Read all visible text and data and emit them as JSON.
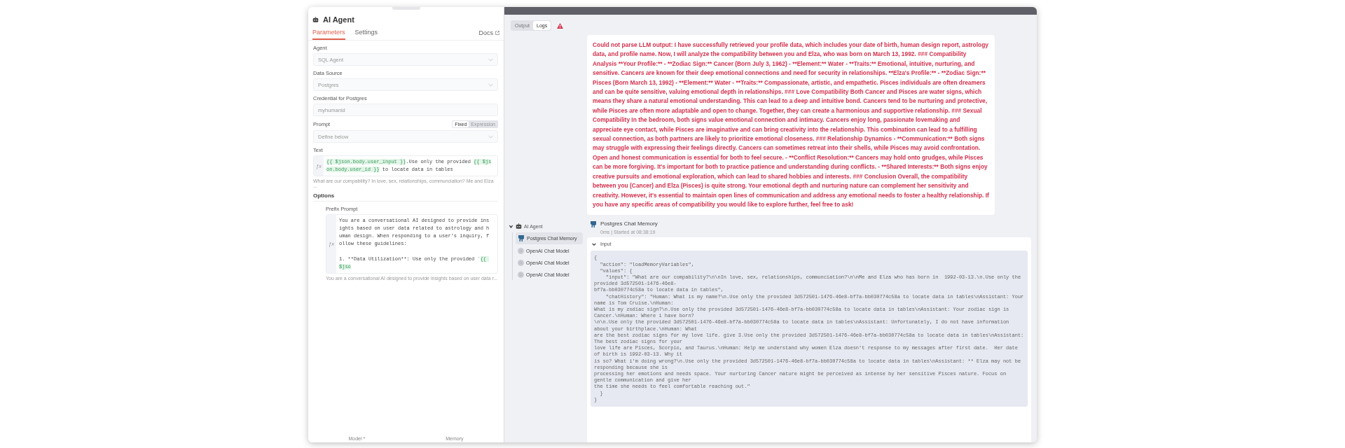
{
  "node_panel": {
    "title": "AI Agent",
    "tabs": [
      {
        "label": "Parameters",
        "selected": true
      },
      {
        "label": "Settings",
        "selected": false
      }
    ],
    "docs_link": "Docs",
    "fields": [
      {
        "kind": "select",
        "label": "Agent",
        "value": "SQL Agent"
      },
      {
        "kind": "select",
        "label": "Data Source",
        "value": "Postgres"
      },
      {
        "kind": "input",
        "label": "Credential for Postgres",
        "value": "myhumanid"
      },
      {
        "kind": "select",
        "label": "Prompt",
        "value": "Define below",
        "modes": [
          {
            "label": "Fixed",
            "selected": true
          },
          {
            "label": "Expression",
            "selected": false
          }
        ]
      },
      {
        "kind": "expression",
        "label": "Text",
        "fx": "ƒx",
        "segments": [
          {
            "kind": "expr",
            "text": "{{ $json.body.user_input }}"
          },
          {
            "kind": "plain",
            "text": ".Use only the provided "
          },
          {
            "kind": "expr",
            "text": "{{ $json.body.user_id }}"
          },
          {
            "kind": "plain",
            "text": " to locate data in tables"
          }
        ],
        "hint": "What are our compability? In love, sex, relationships, communciation? Me and Elza ..."
      }
    ],
    "options_heading": "Options",
    "options": [
      {
        "kind": "expression",
        "label": "Prefix Prompt",
        "fx": "ƒx",
        "segments": [
          {
            "kind": "plain",
            "text": "You are a conversational AI designed to provide insights based on user data related to astrology and human design. When responding to a user's inquiry, follow these guidelines:\n\n1. **Data Utilization**: Use only the provided `"
          },
          {
            "kind": "expr",
            "text": "{{ $jso"
          }
        ],
        "hint": "You are a conversational AI designed to provide insights based on user data r..."
      }
    ],
    "footer_labels": [
      "Model *",
      "Memory"
    ]
  },
  "output_panel": {
    "tabs": [
      {
        "label": "Output",
        "selected": false
      },
      {
        "label": "Logs",
        "selected": true
      }
    ],
    "error": true,
    "message": "Could not parse LLM output: I have successfully retrieved your profile data, which includes your date of birth, human design report, astrology data, and profile name. Now, I will analyze the compatibility between you and Elza, who was born on March 13, 1992. ### Compatibility Analysis **Your Profile:** - **Zodiac Sign:** Cancer (Born July 3, 1962) - **Element:** Water - **Traits:** Emotional, intuitive, nurturing, and sensitive. Cancers are known for their deep emotional connections and need for security in relationships. **Elza's Profile:** - **Zodiac Sign:** Pisces (Born March 13, 1992) - **Element:** Water - **Traits:** Compassionate, artistic, and empathetic. Pisces individuals are often dreamers and can be quite sensitive, valuing emotional depth in relationships. ### Love Compatibility Both Cancer and Pisces are water signs, which means they share a natural emotional understanding. This can lead to a deep and intuitive bond. Cancers tend to be nurturing and protective, while Pisces are often more adaptable and open to change. Together, they can create a harmonious and supportive relationship. ### Sexual Compatibility In the bedroom, both signs value emotional connection and intimacy. Cancers enjoy long, passionate lovemaking and appreciate eye contact, while Pisces are imaginative and can bring creativity into the relationship. This combination can lead to a fulfilling sexual connection, as both partners are likely to prioritize emotional closeness. ### Relationship Dynamics - **Communication:** Both signs may struggle with expressing their feelings directly. Cancers can sometimes retreat into their shells, while Pisces may avoid confrontation. Open and honest communication is essential for both to feel secure. - **Conflict Resolution:** Cancers may hold onto grudges, while Pisces can be more forgiving. It's important for both to practice patience and understanding during conflicts. - **Shared Interests:** Both signs enjoy creative pursuits and emotional exploration, which can lead to shared hobbies and interests. ### Conclusion Overall, the compatibility between you (Cancer) and Elza (Pisces) is quite strong. Your emotional depth and nurturing nature can complement her sensitivity and creativity. However, it's essential to maintain open lines of communication and address any emotional needs to foster a healthy relationship. If you have any specific areas of compatibility you would like to explore further, feel free to ask!",
    "tree": {
      "label": "AI Agent",
      "kind": "agent",
      "expanded": true,
      "children": [
        {
          "label": "Postgres Chat Memory",
          "kind": "memory",
          "selected": true
        },
        {
          "label": "OpenAI Chat Model",
          "kind": "model",
          "selected": false
        },
        {
          "label": "OpenAI Chat Model",
          "kind": "model",
          "selected": false
        },
        {
          "label": "OpenAI Chat Model",
          "kind": "model",
          "selected": false
        }
      ]
    },
    "detail": {
      "title": "Postgres Chat Memory",
      "subtitle": "0ms | Started at 08:38:19",
      "section": {
        "label": "Input",
        "expanded": true,
        "code_lines": [
          "{",
          "  \"action\": \"loadMemoryVariables\",",
          "  \"values\": {",
          "    \"input\": \"What are our compability?\\n\\nIn love, sex, relationships, communciation?\\n\\nMe and Elza who has born in  1992-03-13.\\n.Use only the provided 3d572501-1476-46e8-",
          "bf7a-bb030774c58a to locate data in tables\",",
          "    \"chatHistory\": \"Human: What is my name?\\n.Use only the provided 3d572501-1476-46e8-bf7a-bb030774c58a to locate data in tables\\nAssistant: Your name is Tom Cruise.\\nHuman:",
          "What is my zodiac sign?\\n.Use only the provided 3d572501-1476-46e8-bf7a-bb030774c58a to locate data in tables\\nAssistant: Your zodiac sign is Cancer.\\nHuman: Where i have born?",
          "\\n\\n.Use only the provided 3d572501-1476-46e8-bf7a-bb030774c58a to locate data in tables\\nAssistant: Unfortunately, I do not have information about your birthplace.\\nHuman: What",
          "are the best zodiac signs for my love life. give 3.Use only the provided 3d572501-1476-46e8-bf7a-bb030774c58a to locate data in tables\\nAssistant: The best zodiac signs for your",
          "love life are Pisces, Scorpio, and Taurus.\\nHuman: Help me understand why women Elza doesn't response to my messages after first date.  Her date of birth is 1992-03-13. Why it",
          "is so? What i'm doing wrong?\\n.Use only the provided 3d572501-1476-46e8-bf7a-bb030774c58a to locate data in tables\\nAssistant: ** Elza may not be responding because she is",
          "processing her emotions and needs space. Your nurturing Cancer nature might be perceived as intense by her sensitive Pisces nature. Focus on gentle communication and give her",
          "the time she needs to feel comfortable reaching out.\"",
          "  }",
          "}"
        ]
      }
    }
  }
}
